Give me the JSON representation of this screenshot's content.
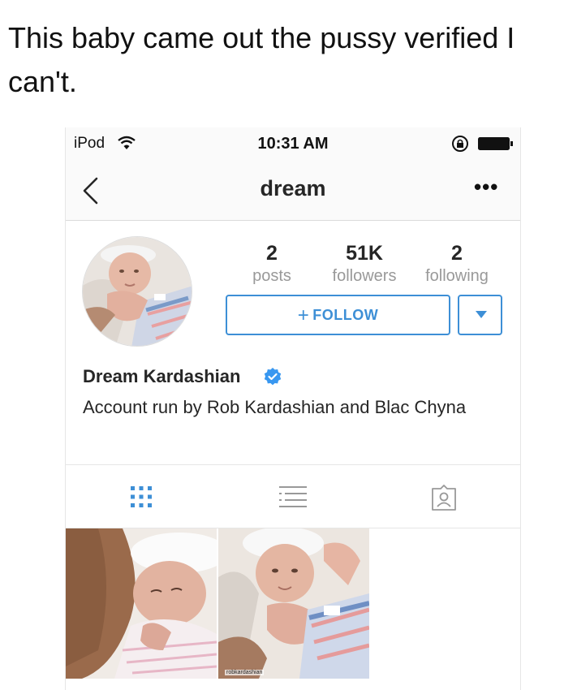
{
  "caption": "This baby came out the pussy verified I can't.",
  "status_bar": {
    "carrier": "iPod",
    "time": "10:31 AM"
  },
  "nav": {
    "title": "dream",
    "more": "•••"
  },
  "profile": {
    "stats": [
      {
        "value": "2",
        "label": "posts"
      },
      {
        "value": "51K",
        "label": "followers"
      },
      {
        "value": "2",
        "label": "following"
      }
    ],
    "follow_label": "FOLLOW",
    "full_name": "Dream Kardashian",
    "bio": "Account run by Rob Kardashian and Blac Chyna"
  },
  "posts": [
    {
      "watermark": ""
    },
    {
      "watermark": "robkardashian"
    }
  ],
  "colors": {
    "accent": "#3d8fd6",
    "verified": "#3897f0",
    "muted_text": "#999999",
    "divider": "#dbdbdb"
  },
  "icons": [
    "wifi-icon",
    "lock-rotation-icon",
    "battery-icon",
    "back-chevron-icon",
    "more-icon",
    "verified-badge-icon",
    "grid-view-icon",
    "list-view-icon",
    "tagged-photos-icon"
  ]
}
